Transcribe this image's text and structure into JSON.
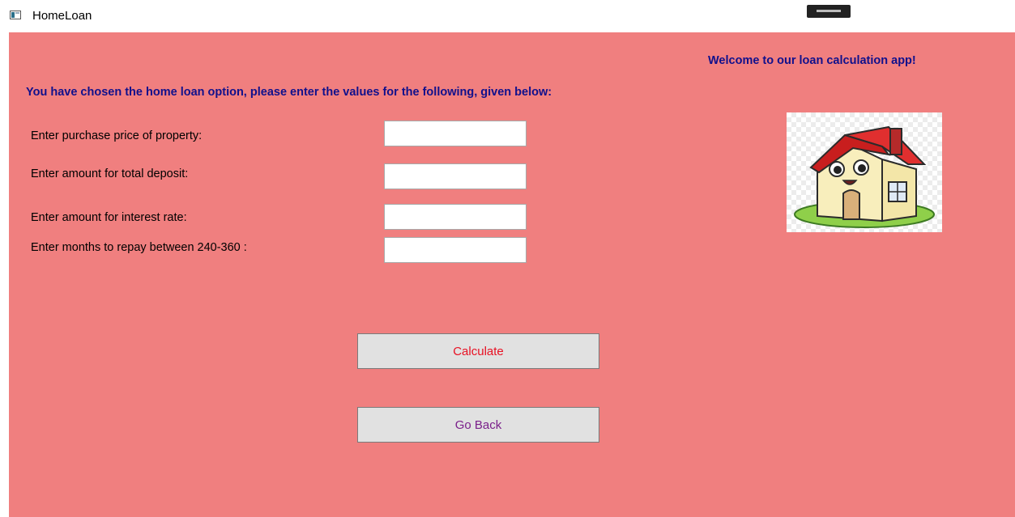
{
  "window": {
    "title": "HomeLoan",
    "icon": "app-window-icon"
  },
  "header": {
    "welcome": "Welcome to our loan calculation app!",
    "instructions": "You have chosen the home loan option, please enter the values for the following, given below:"
  },
  "form": {
    "purchase_price_label": "Enter purchase price of property:",
    "purchase_price_value": "",
    "deposit_label": "Enter amount for total deposit:",
    "deposit_value": "",
    "interest_label": "Enter amount for interest rate:",
    "interest_value": "",
    "months_label": "Enter months to repay between 240-360 :",
    "months_value": ""
  },
  "buttons": {
    "calculate": "Calculate",
    "go_back": "Go Back"
  },
  "image": {
    "icon": "cartoon-house-icon"
  },
  "colors": {
    "background": "#f07f7f",
    "heading_text": "#10108c",
    "calculate_text": "#e81123",
    "go_back_text": "#7a1f8a"
  }
}
